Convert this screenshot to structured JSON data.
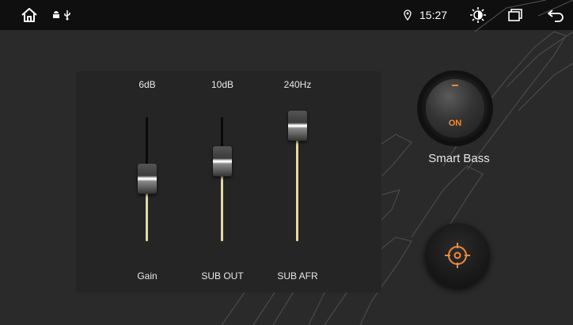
{
  "status_bar": {
    "time": "15:27",
    "icons": [
      "home-icon",
      "android-icon",
      "usb-icon",
      "location-icon",
      "brightness-icon",
      "recent-apps-icon",
      "back-icon"
    ]
  },
  "sliders": [
    {
      "label": "Gain",
      "value": "6dB",
      "level": 0.5
    },
    {
      "label": "SUB OUT",
      "value": "10dB",
      "level": 0.67
    },
    {
      "label": "SUB AFR",
      "value": "240Hz",
      "level": 1.0
    }
  ],
  "smart_bass": {
    "label": "Smart Bass",
    "state": "ON"
  },
  "colors": {
    "accent": "#f08a3a",
    "track_fill": "#e3d9a6",
    "status_bar": "#0f0f10",
    "background": "#2a2a2b"
  }
}
